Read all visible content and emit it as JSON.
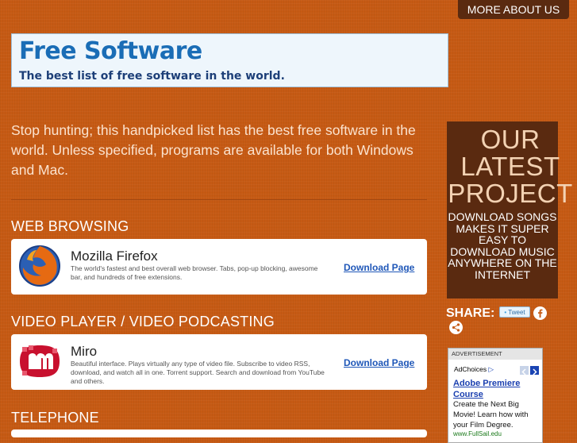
{
  "header": {
    "more_label": "MORE ABOUT US"
  },
  "banner": {
    "title": "Free Software",
    "subtitle": "The best list of free software in the world."
  },
  "intro": "Stop hunting; this handpicked list has the best free software in the world. Unless specified, programs are available for both Windows and Mac.",
  "sections": [
    {
      "title": "WEB BROWSING",
      "app": {
        "name": "Mozilla Firefox",
        "description": "The world's fastest and best overall web browser. Tabs, pop-up blocking, awesome bar, and hundreds of free extensions.",
        "link": "Download Page",
        "icon": "firefox-logo-icon"
      }
    },
    {
      "title": "VIDEO PLAYER / VIDEO PODCASTING",
      "app": {
        "name": "Miro",
        "description": "Beautiful interface. Plays virtually any type of video file. Subscribe to video RSS, download, and watch all in one. Torrent support. Search and download from YouTube and others.",
        "link": "Download Page",
        "icon": "miro-logo-icon"
      }
    },
    {
      "title": "TELEPHONE"
    }
  ],
  "sidebar": {
    "latest_heading": "OUR LATEST PROJECT",
    "latest_text": "DOWNLOAD SONGS MAKES IT SUPER EASY TO DOWNLOAD MUSIC ANYWHERE ON THE INTERNET",
    "share_label": "SHARE:",
    "tweet_label": "Tweet",
    "icons": [
      "twitter-bird-icon",
      "facebook-icon",
      "share-icon"
    ]
  },
  "ad": {
    "header": "ADVERTISEMENT",
    "adchoices": "AdChoices",
    "title": "Adobe Premiere Course",
    "text": "Create the Next Big Movie! Learn how with your Film Degree.",
    "url": "www.FullSail.edu"
  },
  "colors": {
    "background": "#c65a14",
    "dark_brown": "#5a2a10",
    "link_blue": "#1f57b8",
    "banner_blue": "#1a6db6"
  }
}
